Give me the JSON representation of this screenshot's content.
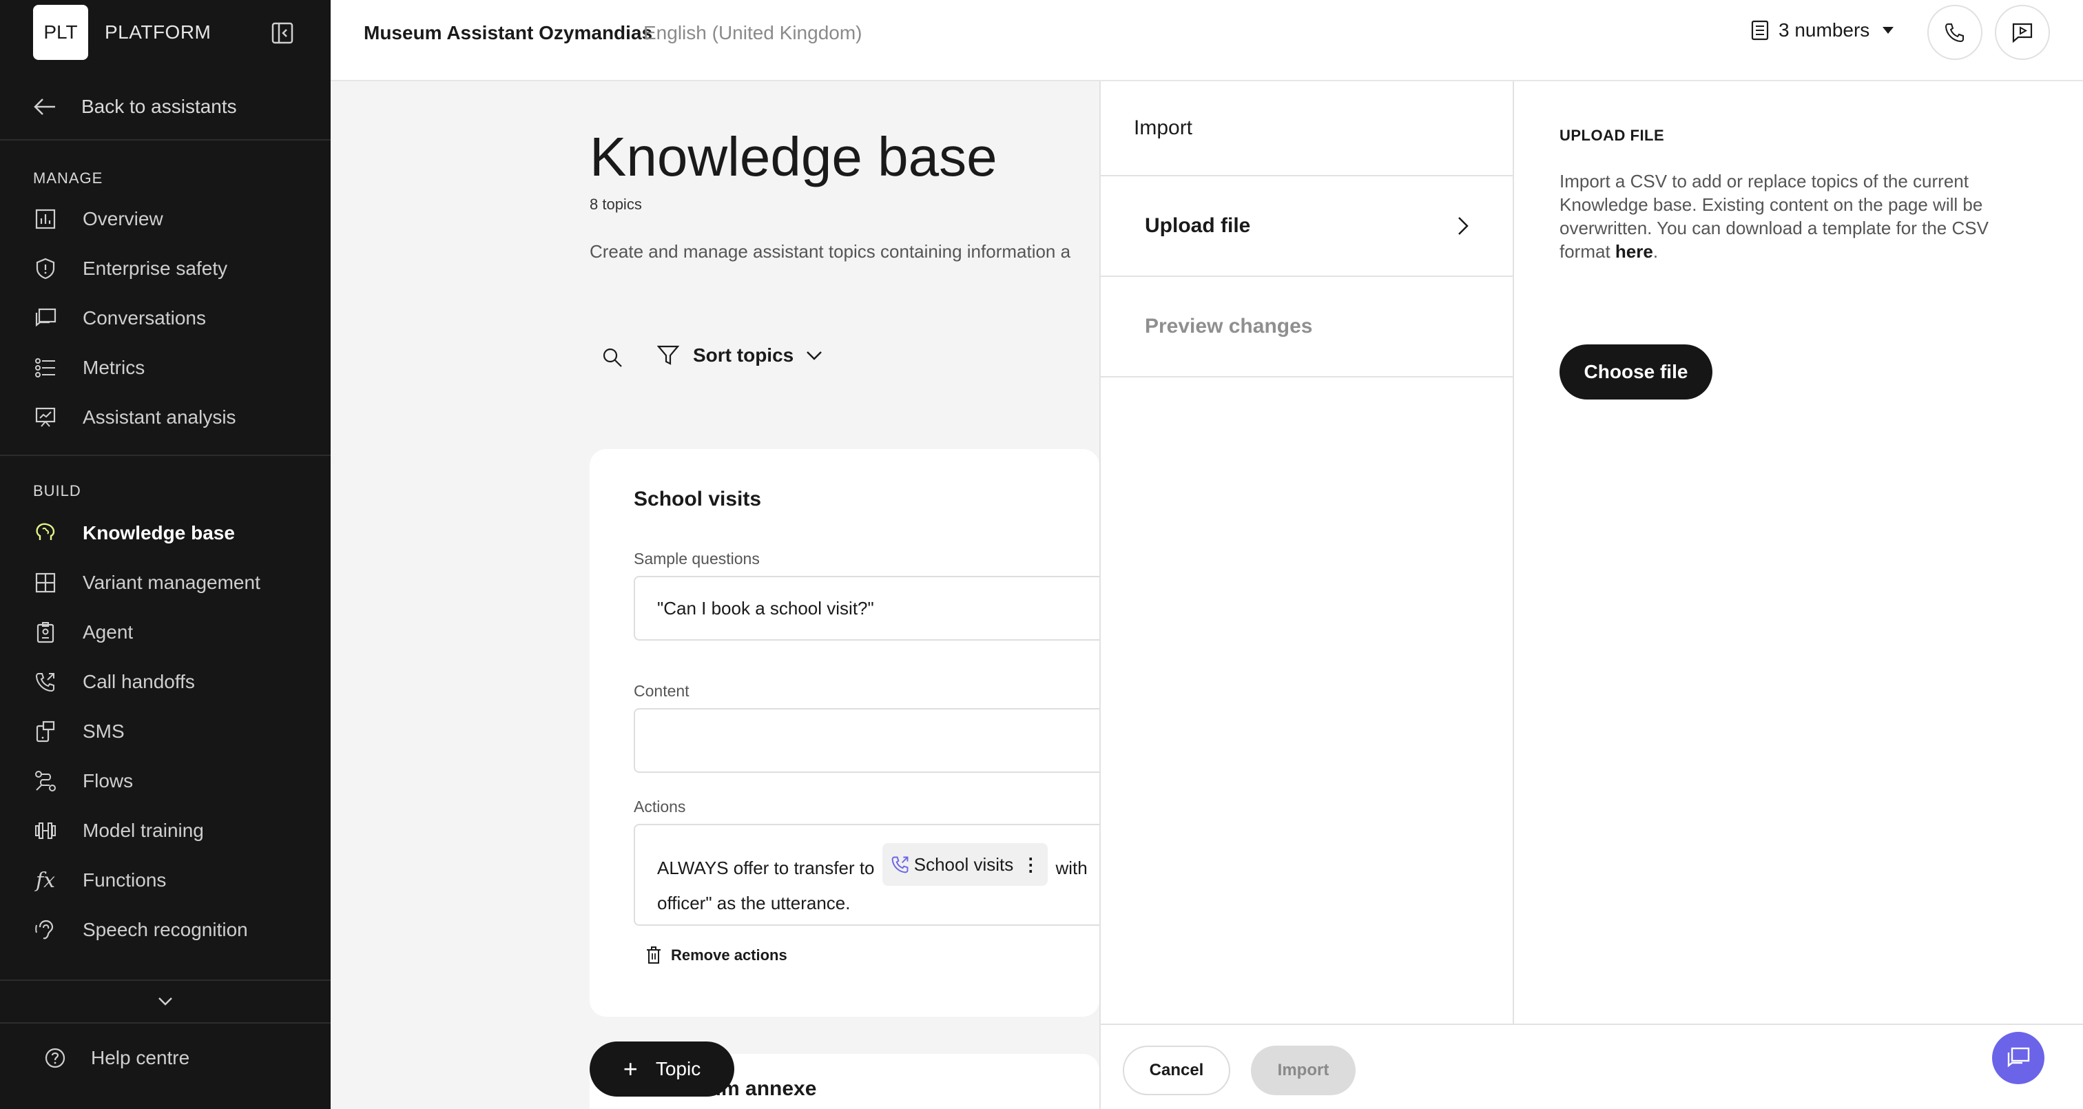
{
  "sidebar": {
    "logo": "PLT",
    "brand": "PLATFORM",
    "back": "Back to assistants",
    "manage_title": "MANAGE",
    "manage_items": [
      {
        "label": "Overview",
        "icon": "bar-chart-icon"
      },
      {
        "label": "Enterprise safety",
        "icon": "shield-icon"
      },
      {
        "label": "Conversations",
        "icon": "chat-icon"
      },
      {
        "label": "Metrics",
        "icon": "list-icon"
      },
      {
        "label": "Assistant analysis",
        "icon": "presentation-icon"
      }
    ],
    "build_title": "BUILD",
    "build_items": [
      {
        "label": "Knowledge base",
        "icon": "brain-icon",
        "active": true
      },
      {
        "label": "Variant management",
        "icon": "grid-icon"
      },
      {
        "label": "Agent",
        "icon": "badge-icon"
      },
      {
        "label": "Call handoffs",
        "icon": "phone-forward-icon"
      },
      {
        "label": "SMS",
        "icon": "sms-icon"
      },
      {
        "label": "Flows",
        "icon": "flow-icon"
      },
      {
        "label": "Model training",
        "icon": "dumbbell-icon"
      },
      {
        "label": "Functions",
        "icon": "function-icon"
      },
      {
        "label": "Speech recognition",
        "icon": "ear-icon"
      }
    ],
    "help": "Help centre"
  },
  "topbar": {
    "title": "Museum Assistant Ozymandias",
    "language": "English (United Kingdom)",
    "numbers": "3 numbers"
  },
  "main": {
    "title": "Knowledge base",
    "topic_count": "8 topics",
    "description": "Create and manage assistant topics containing information a",
    "sort_label": "Sort topics",
    "card": {
      "title": "School visits",
      "sample_label": "Sample questions",
      "sample_value": "\"Can I book a school visit?\"",
      "content_label": "Content",
      "actions_label": "Actions",
      "action_prefix": "ALWAYS offer to transfer to",
      "action_chip": "School visits",
      "action_suffix": "with",
      "action_line2": "officer\" as the utterance.",
      "remove_actions": "Remove actions"
    },
    "card2_title_partial": "eum annexe",
    "topic_button": "Topic"
  },
  "import_panel": {
    "title": "Import",
    "steps": [
      {
        "label": "Upload file",
        "state": "active"
      },
      {
        "label": "Preview changes",
        "state": "disabled"
      }
    ],
    "upload_heading": "UPLOAD FILE",
    "upload_text": "Import a CSV to add or replace topics of the current Knowledge base. Existing content on the page will be overwritten. You can download a template for the CSV format",
    "upload_link": "here",
    "upload_text_end": ".",
    "choose_file": "Choose file",
    "cancel": "Cancel",
    "import": "Import"
  },
  "colors": {
    "sidebar_bg": "#161616",
    "accent": "#6b64e8",
    "active_icon": "#e5f28a"
  }
}
